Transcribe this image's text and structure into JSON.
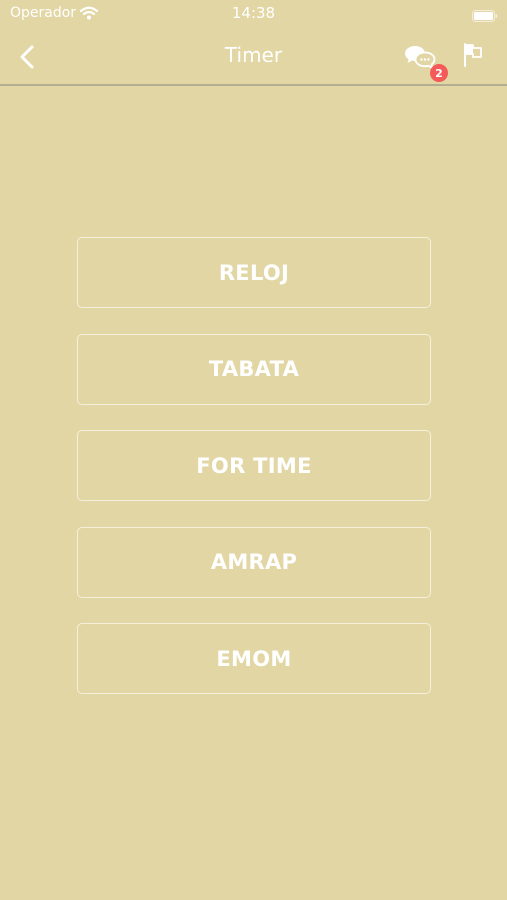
{
  "status_bar": {
    "carrier": "Operador",
    "time": "14:38"
  },
  "nav": {
    "title": "Timer",
    "chat_badge_count": "2",
    "icons": {
      "back": "chevron-left-icon",
      "chat": "chat-bubbles-icon",
      "flag": "flag-icon"
    }
  },
  "menu": {
    "items": [
      {
        "label": "RELOJ"
      },
      {
        "label": "TABATA"
      },
      {
        "label": "FOR TIME"
      },
      {
        "label": "AMRAP"
      },
      {
        "label": "EMOM"
      }
    ]
  },
  "colors": {
    "background": "#e2d6a5",
    "badge": "#f35a58",
    "text": "#ffffff"
  }
}
